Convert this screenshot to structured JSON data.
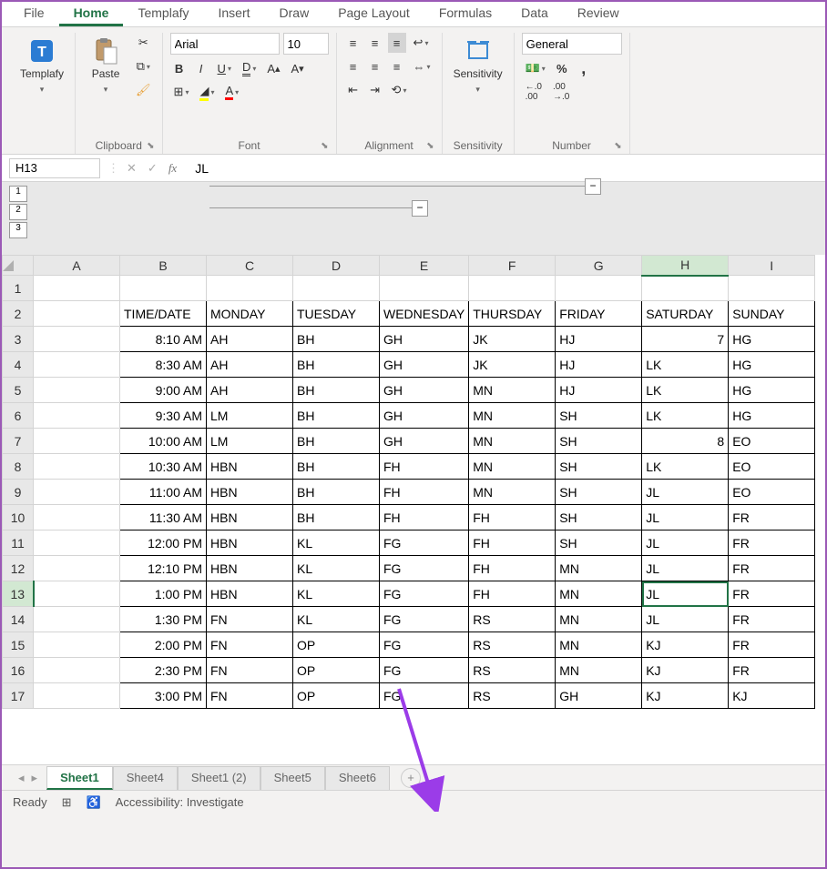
{
  "ribbon_tabs": [
    "File",
    "Home",
    "Templafy",
    "Insert",
    "Draw",
    "Page Layout",
    "Formulas",
    "Data",
    "Review"
  ],
  "active_ribbon_tab": 1,
  "groups": {
    "templafy": "Templafy",
    "clipboard": "Clipboard",
    "paste": "Paste",
    "font": "Font",
    "alignment": "Alignment",
    "sensitivity": "Sensitivity",
    "number": "Number"
  },
  "font_name": "Arial",
  "font_size": "10",
  "number_format": "General",
  "name_box": "H13",
  "formula_value": "JL",
  "outline_levels": [
    "1",
    "2",
    "3"
  ],
  "columns": [
    "A",
    "B",
    "C",
    "D",
    "E",
    "F",
    "G",
    "H",
    "I"
  ],
  "selected_col": 7,
  "selected_row": 13,
  "rows": [
    {
      "n": 1,
      "cells": [
        "",
        "",
        "",
        "",
        "",
        "",
        "",
        "",
        ""
      ]
    },
    {
      "n": 2,
      "cells": [
        "",
        "TIME/DATE",
        "MONDAY",
        "TUESDAY",
        "WEDNESDAY",
        "THURSDAY",
        "FRIDAY",
        "SATURDAY",
        "SUNDAY"
      ]
    },
    {
      "n": 3,
      "cells": [
        "",
        "8:10 AM",
        "AH",
        "BH",
        "GH",
        "JK",
        "HJ",
        "7",
        "HG"
      ]
    },
    {
      "n": 4,
      "cells": [
        "",
        "8:30 AM",
        "AH",
        "BH",
        "GH",
        "JK",
        "HJ",
        "LK",
        "HG"
      ]
    },
    {
      "n": 5,
      "cells": [
        "",
        "9:00 AM",
        "AH",
        "BH",
        "GH",
        "MN",
        "HJ",
        "LK",
        "HG"
      ]
    },
    {
      "n": 6,
      "cells": [
        "",
        "9:30 AM",
        "LM",
        "BH",
        "GH",
        "MN",
        "SH",
        "LK",
        "HG"
      ]
    },
    {
      "n": 7,
      "cells": [
        "",
        "10:00 AM",
        "LM",
        "BH",
        "GH",
        "MN",
        "SH",
        "8",
        "EO"
      ]
    },
    {
      "n": 8,
      "cells": [
        "",
        "10:30 AM",
        "HBN",
        "BH",
        "FH",
        "MN",
        "SH",
        "LK",
        "EO"
      ]
    },
    {
      "n": 9,
      "cells": [
        "",
        "11:00 AM",
        "HBN",
        "BH",
        "FH",
        "MN",
        "SH",
        "JL",
        "EO"
      ]
    },
    {
      "n": 10,
      "cells": [
        "",
        "11:30 AM",
        "HBN",
        "BH",
        "FH",
        "FH",
        "SH",
        "JL",
        "FR"
      ]
    },
    {
      "n": 11,
      "cells": [
        "",
        "12:00 PM",
        "HBN",
        "KL",
        "FG",
        "FH",
        "SH",
        "JL",
        "FR"
      ]
    },
    {
      "n": 12,
      "cells": [
        "",
        "12:10 PM",
        "HBN",
        "KL",
        "FG",
        "FH",
        "MN",
        "JL",
        "FR"
      ]
    },
    {
      "n": 13,
      "cells": [
        "",
        "1:00 PM",
        "HBN",
        "KL",
        "FG",
        "FH",
        "MN",
        "JL",
        "FR"
      ]
    },
    {
      "n": 14,
      "cells": [
        "",
        "1:30 PM",
        "FN",
        "KL",
        "FG",
        "RS",
        "MN",
        "JL",
        "FR"
      ]
    },
    {
      "n": 15,
      "cells": [
        "",
        "2:00 PM",
        "FN",
        "OP",
        "FG",
        "RS",
        "MN",
        "KJ",
        "FR"
      ]
    },
    {
      "n": 16,
      "cells": [
        "",
        "2:30 PM",
        "FN",
        "OP",
        "FG",
        "RS",
        "MN",
        "KJ",
        "FR"
      ]
    },
    {
      "n": 17,
      "cells": [
        "",
        "3:00 PM",
        "FN",
        "OP",
        "FG",
        "RS",
        "GH",
        "KJ",
        "KJ"
      ]
    }
  ],
  "ralign_cols": [
    1
  ],
  "ralign_cells": [
    [
      3,
      7
    ],
    [
      7,
      7
    ]
  ],
  "sheet_tabs": [
    "Sheet1",
    "Sheet4",
    "Sheet1 (2)",
    "Sheet5",
    "Sheet6"
  ],
  "active_sheet": 0,
  "status_ready": "Ready",
  "status_accessibility": "Accessibility: Investigate"
}
